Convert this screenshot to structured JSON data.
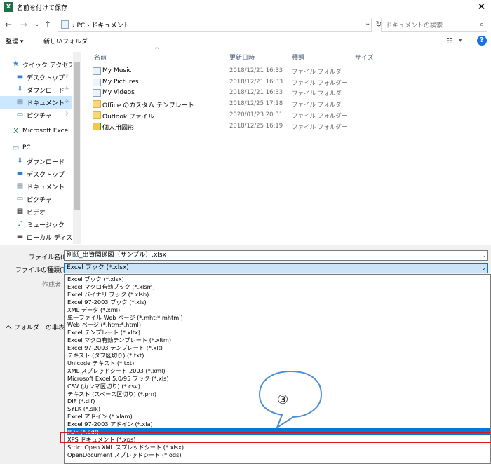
{
  "window": {
    "title": "名前を付けて保存",
    "close": "✕"
  },
  "nav_buttons": {
    "back": "←",
    "forward": "→",
    "dropdown": "⌄",
    "up": "↑"
  },
  "address": {
    "path": "› PC › ドキュメント",
    "dropdown": "⌄",
    "refresh": "↻"
  },
  "search": {
    "placeholder": "ドキュメントの検索",
    "icon": "⌕"
  },
  "toolbar": {
    "organize": "整理 ▾",
    "new_folder": "新しいフォルダー",
    "view_icon": "☷",
    "view_dropdown": "▾",
    "help": "?"
  },
  "nav_pane": {
    "items": [
      {
        "label": "クイック アクセス",
        "icon": "★",
        "color": "#2f80d8",
        "indent": 0,
        "pinned": false
      },
      {
        "label": "デスクトップ",
        "icon": "▬",
        "color": "#2f80d8",
        "indent": 1,
        "pinned": true
      },
      {
        "label": "ダウンロード",
        "icon": "⬇",
        "color": "#2f80d8",
        "indent": 1,
        "pinned": true
      },
      {
        "label": "ドキュメント",
        "icon": "▤",
        "color": "#6b7f99",
        "indent": 1,
        "pinned": true,
        "selected": true
      },
      {
        "label": "ピクチャ",
        "icon": "▭",
        "color": "#2f80d8",
        "indent": 1,
        "pinned": true
      },
      {
        "label": "Microsoft Excel",
        "icon": "X",
        "color": "#1e7145",
        "indent": 0,
        "pinned": false
      },
      {
        "label": "PC",
        "icon": "▭",
        "color": "#2f80d8",
        "indent": 0,
        "pinned": false
      },
      {
        "label": "ダウンロード",
        "icon": "⬇",
        "color": "#2f80d8",
        "indent": 1,
        "pinned": false
      },
      {
        "label": "デスクトップ",
        "icon": "▬",
        "color": "#2f80d8",
        "indent": 1,
        "pinned": false
      },
      {
        "label": "ドキュメント",
        "icon": "▤",
        "color": "#6b7f99",
        "indent": 1,
        "pinned": false
      },
      {
        "label": "ピクチャ",
        "icon": "▭",
        "color": "#2f80d8",
        "indent": 1,
        "pinned": false
      },
      {
        "label": "ビデオ",
        "icon": "▦",
        "color": "#333333",
        "indent": 1,
        "pinned": false
      },
      {
        "label": "ミュージック",
        "icon": "♪",
        "color": "#2f80d8",
        "indent": 1,
        "pinned": false
      },
      {
        "label": "ローカル ディスク (C",
        "icon": "▬",
        "color": "#555555",
        "indent": 1,
        "pinned": false
      }
    ],
    "pin_glyph": "✈"
  },
  "file_list": {
    "columns": {
      "name": "名前",
      "modified": "更新日時",
      "type": "種類",
      "size": "サイズ"
    },
    "sort_arrow": "^",
    "rows": [
      {
        "name": "My Music",
        "date": "2018/12/21 16:33",
        "type": "ファイル フォルダー",
        "icon": "library"
      },
      {
        "name": "My Pictures",
        "date": "2018/12/21 16:33",
        "type": "ファイル フォルダー",
        "icon": "library"
      },
      {
        "name": "My Videos",
        "date": "2018/12/21 16:33",
        "type": "ファイル フォルダー",
        "icon": "library"
      },
      {
        "name": "Office のカスタム テンプレート",
        "date": "2018/12/25 17:18",
        "type": "ファイル フォルダー",
        "icon": "folder"
      },
      {
        "name": "Outlook ファイル",
        "date": "2020/01/23 20:31",
        "type": "ファイル フォルダー",
        "icon": "folder"
      },
      {
        "name": "個人用図形",
        "date": "2018/12/25 16:19",
        "type": "ファイル フォルダー",
        "icon": "shapes"
      }
    ]
  },
  "form": {
    "filename_label": "ファイル名(N):",
    "filename_value": "別紙_出資関係図（サンプル）.xlsx",
    "filetype_label": "ファイルの種類(T):",
    "filetype_value": "Excel ブック (*.xlsx)",
    "author_label": "作成者:",
    "dropdown_glyph": "⌄",
    "hide_folders": "ヘ フォルダーの非表示"
  },
  "filetype_options": [
    "Excel ブック (*.xlsx)",
    "Excel マクロ有効ブック (*.xlsm)",
    "Excel バイナリ ブック (*.xlsb)",
    "Excel 97-2003 ブック (*.xls)",
    "XML データ (*.xml)",
    "単一ファイル Web ページ (*.mht;*.mhtml)",
    "Web ページ (*.htm;*.html)",
    "Excel テンプレート (*.xltx)",
    "Excel マクロ有効テンプレート (*.xltm)",
    "Excel 97-2003 テンプレート (*.xlt)",
    "テキスト (タブ区切り) (*.txt)",
    "Unicode テキスト (*.txt)",
    "XML スプレッドシート 2003 (*.xml)",
    "Microsoft Excel 5.0/95 ブック (*.xls)",
    "CSV (カンマ区切り) (*.csv)",
    "テキスト (スペース区切り) (*.prn)",
    "DIF (*.dif)",
    "SYLK (*.slk)",
    "Excel アドイン (*.xlam)",
    "Excel 97-2003 アドイン (*.xla)",
    "PDF (*.pdf)",
    "XPS ドキュメント (*.xps)",
    "Strict Open XML スプレッドシート (*.xlsx)",
    "OpenDocument スプレッドシート (*.ods)"
  ],
  "selected_option_index": 20,
  "callout": {
    "label": "③"
  },
  "colors": {
    "accent": "#0078d7",
    "highlight_box": "#e0141e",
    "selection": "#cce8ff"
  }
}
